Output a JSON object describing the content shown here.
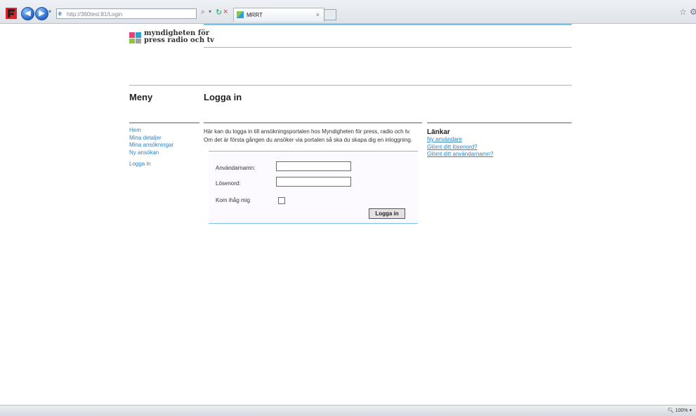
{
  "browser": {
    "address": "http://360test:81/Login",
    "tab_title": "MRRT",
    "search_icon": "search-icon",
    "zoom": "100%"
  },
  "site": {
    "logo_line1": "myndigheten för",
    "logo_line2": "press radio och tv",
    "logo_colors": [
      "#e4407a",
      "#2aa3d8",
      "#8dc63f",
      "#a0a0a0"
    ]
  },
  "menu": {
    "heading": "Meny",
    "items": [
      "Hem",
      "Mina detaljer",
      "Mina ansökningar",
      "Ny ansökan"
    ],
    "logout": "Logga in"
  },
  "main": {
    "heading": "Logga in",
    "intro_line1": "Här kan du logga in till ansökningsportalen hos Myndigheten för press, radio och tv.",
    "intro_line2": "Om det är första gången du ansöker via portalen så ska du skapa dig en inloggning."
  },
  "form": {
    "username_label": "Användarnamn:",
    "username_value": "",
    "password_label": "Lösenord:",
    "password_value": "",
    "remember_label": "Kom ihåg mig",
    "remember_checked": false,
    "submit_label": "Logga in"
  },
  "links": {
    "heading": "Länkar",
    "items": [
      "Ny användare",
      "Glömt ditt lösenord?",
      "Glömt ditt användarnamn?"
    ]
  },
  "colors": {
    "accent": "#2b84c6",
    "rule": "#7cc3e6"
  }
}
